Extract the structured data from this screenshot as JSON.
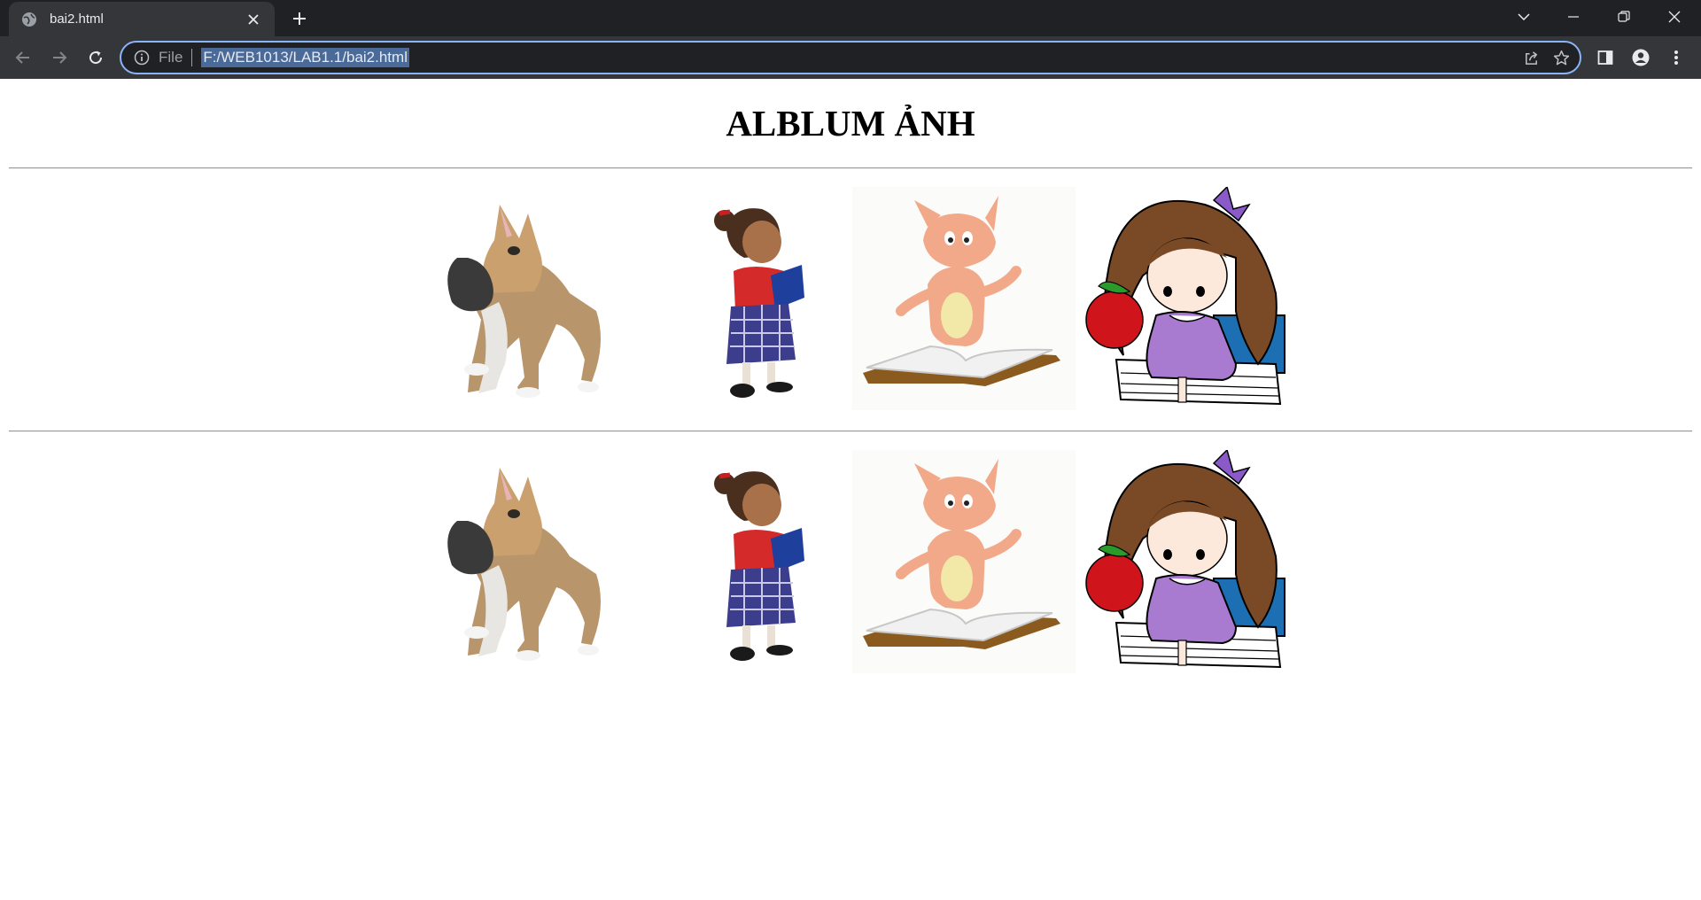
{
  "browser": {
    "tab_title": "bai2.html",
    "address_scheme": "File",
    "address_url": "F:/WEB1013/LAB1.1/bai2.html"
  },
  "page": {
    "heading": "ALBLUM ẢNH",
    "rows": [
      {
        "images": [
          "dog",
          "girl-reading",
          "cat-on-book",
          "girl-with-apple"
        ]
      },
      {
        "images": [
          "dog",
          "girl-reading",
          "cat-on-book",
          "girl-with-apple"
        ]
      }
    ]
  },
  "colors": {
    "frame": "#202124",
    "toolbar": "#35363a",
    "focus_ring": "#8ab4f8",
    "page_bg": "#ffffff"
  }
}
